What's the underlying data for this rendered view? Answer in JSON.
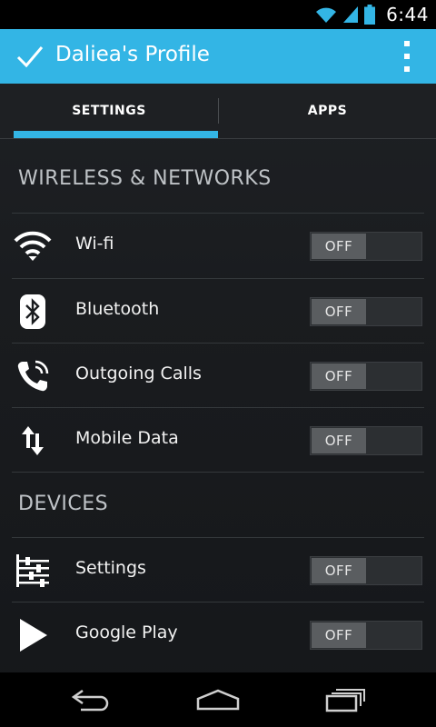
{
  "status_bar": {
    "time": "6:44",
    "icons": [
      "wifi-icon",
      "signal-icon",
      "battery-icon"
    ]
  },
  "action_bar": {
    "title": "Daliea's Profile",
    "icons": [
      "check-icon",
      "overflow-menu-icon"
    ],
    "color": "#33b5e5"
  },
  "tabs": [
    {
      "label": "SETTINGS",
      "selected": true
    },
    {
      "label": "APPS",
      "selected": false
    }
  ],
  "sections": [
    {
      "header": "WIRELESS & NETWORKS",
      "items": [
        {
          "label": "Wi-fi",
          "icon": "wifi-icon",
          "toggle": "OFF"
        },
        {
          "label": "Bluetooth",
          "icon": "bluetooth-icon",
          "toggle": "OFF"
        },
        {
          "label": "Outgoing Calls",
          "icon": "phone-call-icon",
          "toggle": "OFF"
        },
        {
          "label": "Mobile Data",
          "icon": "mobile-data-icon",
          "toggle": "OFF"
        }
      ]
    },
    {
      "header": "DEVICES",
      "items": [
        {
          "label": "Settings",
          "icon": "sliders-icon",
          "toggle": "OFF"
        },
        {
          "label": "Google Play",
          "icon": "play-icon",
          "toggle": "OFF"
        }
      ]
    }
  ],
  "nav_bar": {
    "icons": [
      "back-icon",
      "home-icon",
      "recent-apps-icon"
    ]
  }
}
